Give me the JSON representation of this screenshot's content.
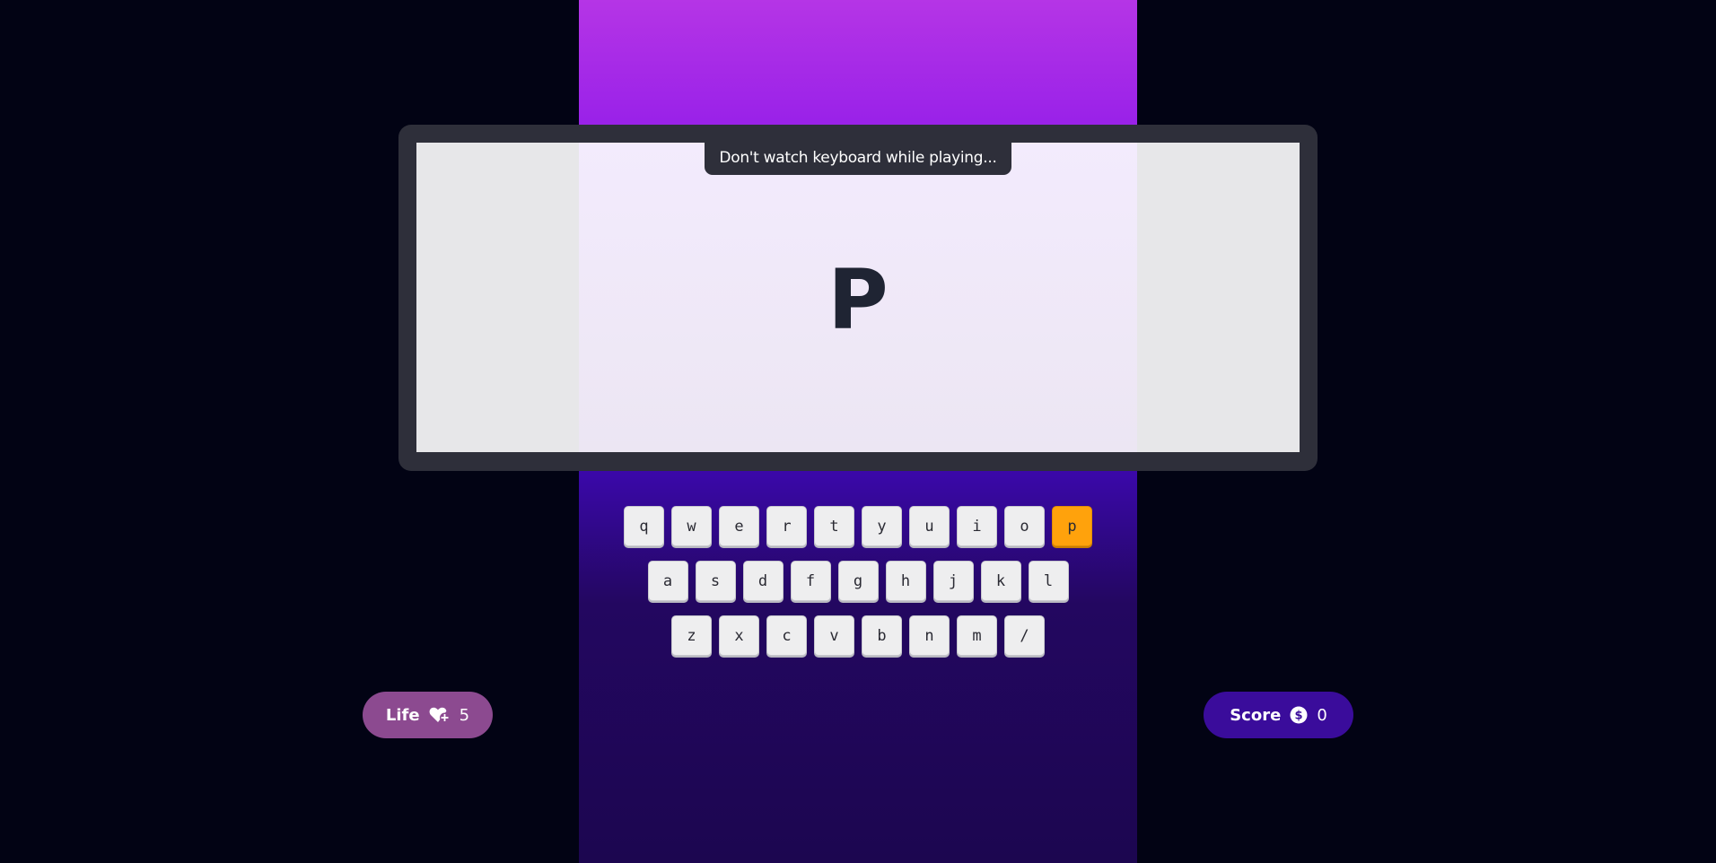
{
  "hint": "Don't watch keyboard while playing...",
  "current_letter": "P",
  "keyboard": {
    "rows": [
      [
        "q",
        "w",
        "e",
        "r",
        "t",
        "y",
        "u",
        "i",
        "o",
        "p"
      ],
      [
        "a",
        "s",
        "d",
        "f",
        "g",
        "h",
        "j",
        "k",
        "l"
      ],
      [
        "z",
        "x",
        "c",
        "v",
        "b",
        "n",
        "m",
        "/"
      ]
    ],
    "active_key": "p",
    "active_color": "#ffa20c"
  },
  "life": {
    "label": "Life",
    "icon": "heart-plus-icon",
    "value": "5",
    "color": "#8c4a90"
  },
  "score": {
    "label": "Score",
    "icon": "dollar-coin-icon",
    "value": "0",
    "color": "#3a0c9b"
  }
}
